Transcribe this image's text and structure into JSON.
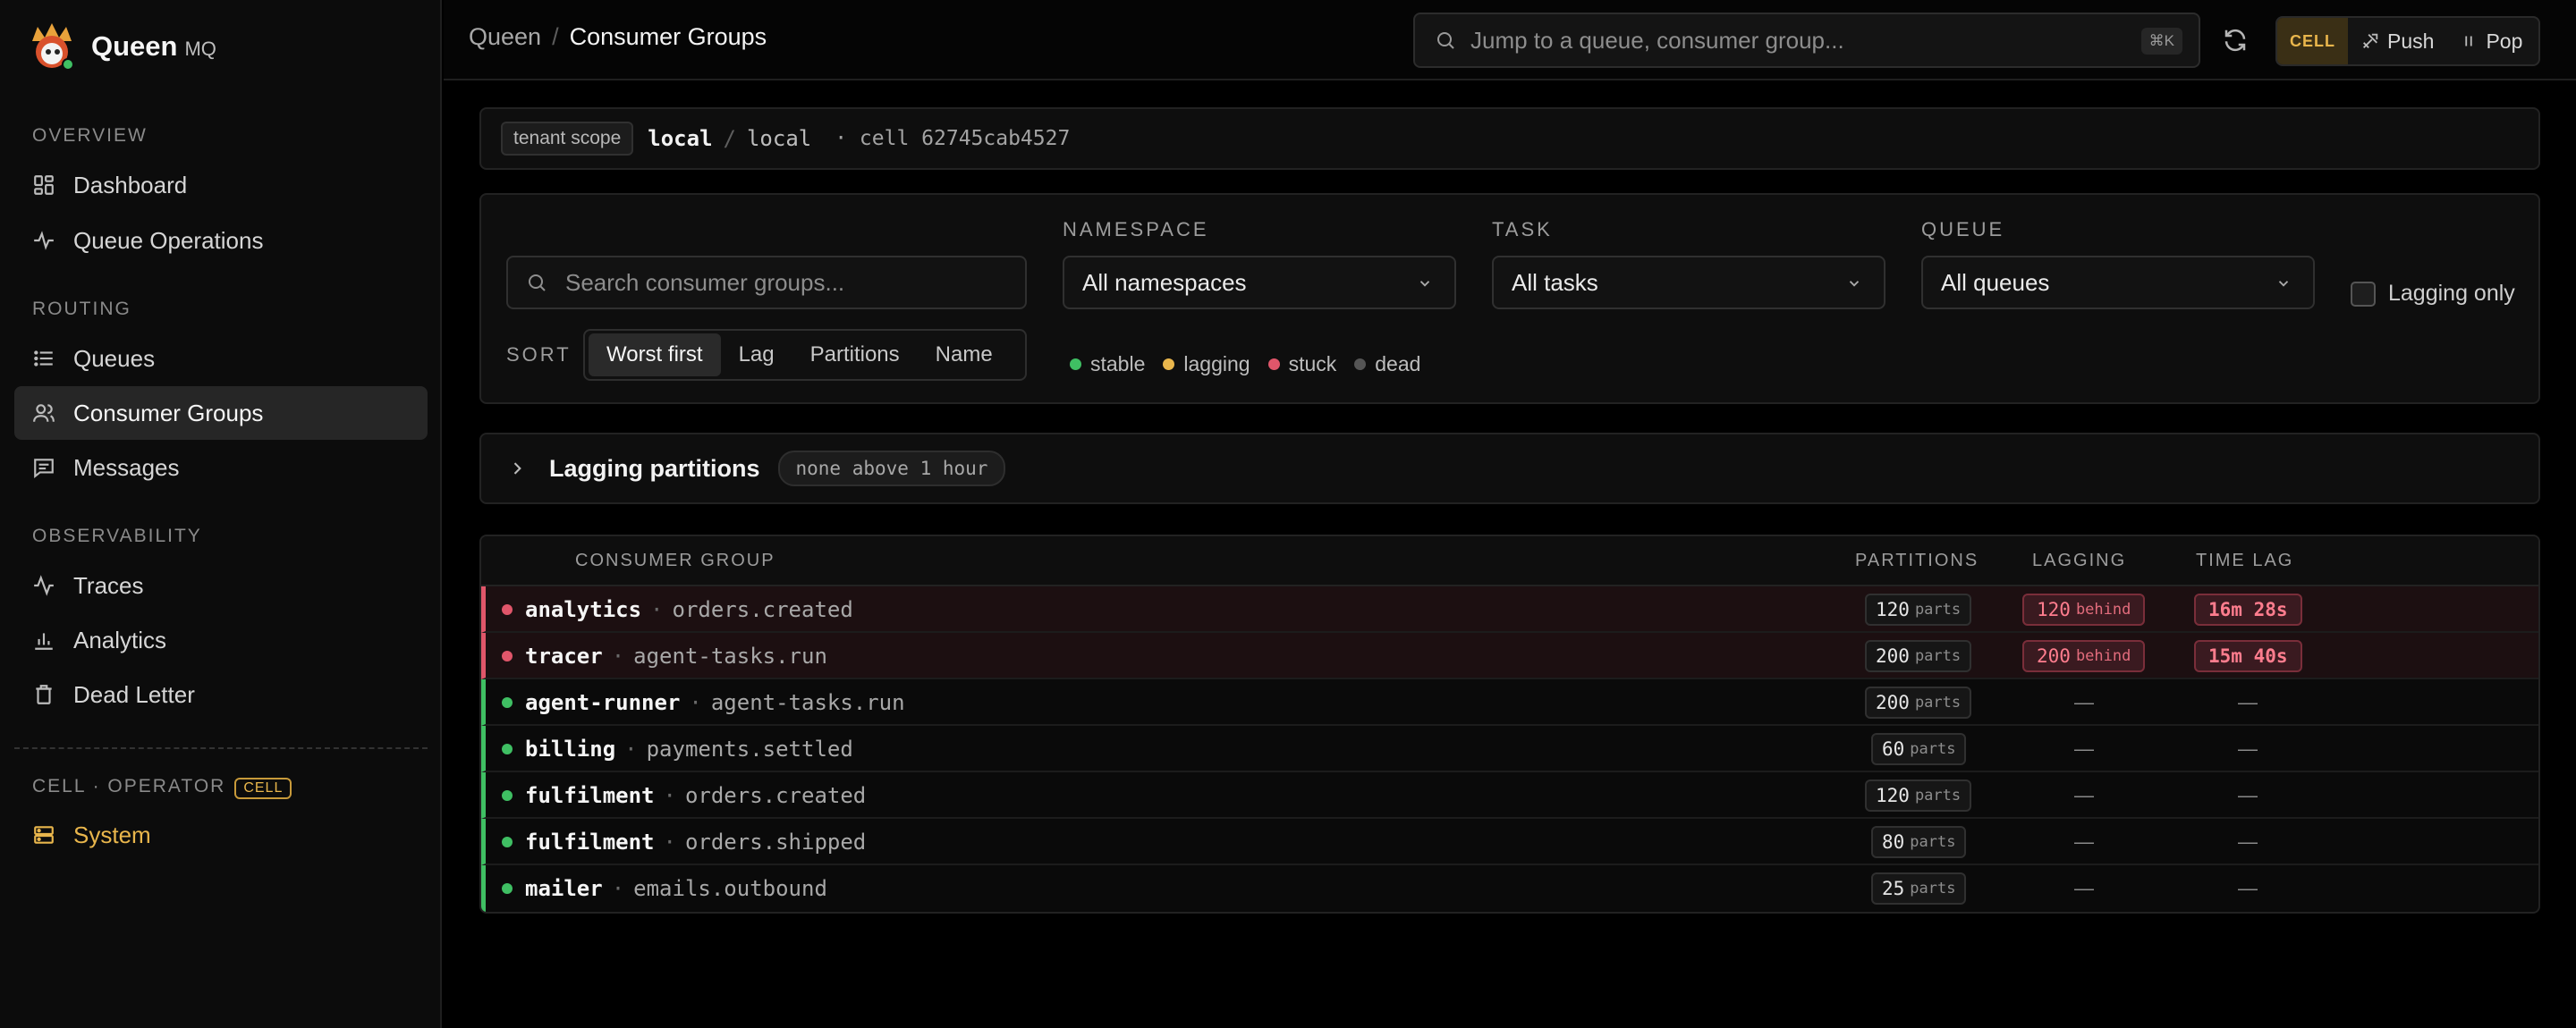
{
  "brand": {
    "name": "Queen",
    "sub": "MQ"
  },
  "sidebar": {
    "sections": [
      {
        "label": "OVERVIEW"
      },
      {
        "label": "ROUTING"
      },
      {
        "label": "OBSERVABILITY"
      },
      {
        "label": "CELL · OPERATOR",
        "badge": "CELL"
      }
    ],
    "items": [
      {
        "label": "Dashboard",
        "icon": "dashboard-icon"
      },
      {
        "label": "Queue Operations",
        "icon": "activity-icon"
      },
      {
        "label": "Queues",
        "icon": "list-icon"
      },
      {
        "label": "Consumer Groups",
        "icon": "users-icon",
        "active": true
      },
      {
        "label": "Messages",
        "icon": "message-icon"
      },
      {
        "label": "Traces",
        "icon": "pulse-icon"
      },
      {
        "label": "Analytics",
        "icon": "bar-chart-icon"
      },
      {
        "label": "Dead Letter",
        "icon": "trash-icon"
      },
      {
        "label": "System",
        "icon": "server-icon",
        "accent": "#e9b64c"
      }
    ]
  },
  "topbar": {
    "breadcrumb": {
      "parent": "Queen",
      "separator": "/",
      "current": "Consumer Groups"
    },
    "jump": {
      "placeholder": "Jump to a queue, consumer group...",
      "shortcut": "⌘K"
    },
    "cell_label": "CELL",
    "push_label": "Push",
    "pop_label": "Pop"
  },
  "tenant": {
    "chip": "tenant scope",
    "namespace": "local",
    "separator": "/",
    "env": "local",
    "cell": "· cell 62745cab4527"
  },
  "filters": {
    "search_placeholder": "Search consumer groups...",
    "namespace": {
      "label": "NAMESPACE",
      "value": "All namespaces"
    },
    "task": {
      "label": "TASK",
      "value": "All tasks"
    },
    "queue": {
      "label": "QUEUE",
      "value": "All queues"
    },
    "lagging_only": "Lagging only",
    "sort": {
      "label": "SORT",
      "options": [
        "Worst first",
        "Lag",
        "Partitions",
        "Name"
      ],
      "active": "Worst first"
    },
    "legend": [
      {
        "label": "stable",
        "color": "#3fbf63"
      },
      {
        "label": "lagging",
        "color": "#e9b64c"
      },
      {
        "label": "stuck",
        "color": "#e0566a"
      },
      {
        "label": "dead",
        "color": "#555555"
      }
    ]
  },
  "lagging_partitions": {
    "title": "Lagging partitions",
    "chip": "none above 1 hour"
  },
  "table": {
    "headers": {
      "group": "CONSUMER GROUP",
      "partitions": "PARTITIONS",
      "lagging": "LAGGING",
      "time_lag": "TIME LAG"
    },
    "parts_unit": "parts",
    "behind_unit": "behind",
    "empty": "—",
    "rows": [
      {
        "name": "analytics",
        "sep": "·",
        "queue": "orders.created",
        "partitions": "120",
        "status": "stuck",
        "lagging": "120",
        "time_lag": "16m 28s"
      },
      {
        "name": "tracer",
        "sep": "·",
        "queue": "agent-tasks.run",
        "partitions": "200",
        "status": "stuck",
        "lagging": "200",
        "time_lag": "15m 40s"
      },
      {
        "name": "agent-runner",
        "sep": "·",
        "queue": "agent-tasks.run",
        "partitions": "200",
        "status": "stable"
      },
      {
        "name": "billing",
        "sep": "·",
        "queue": "payments.settled",
        "partitions": "60",
        "status": "stable"
      },
      {
        "name": "fulfilment",
        "sep": "·",
        "queue": "orders.created",
        "partitions": "120",
        "status": "stable"
      },
      {
        "name": "fulfilment",
        "sep": "·",
        "queue": "orders.shipped",
        "partitions": "80",
        "status": "stable"
      },
      {
        "name": "mailer",
        "sep": "·",
        "queue": "emails.outbound",
        "partitions": "25",
        "status": "stable"
      }
    ]
  }
}
